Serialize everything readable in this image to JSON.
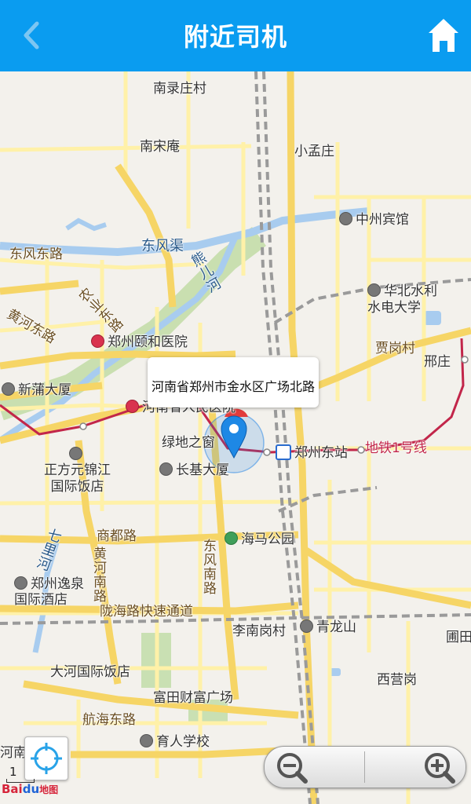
{
  "header": {
    "title": "附近司机",
    "back_icon": "chevron-left-icon",
    "home_icon": "home-icon",
    "background": "#0a9cf0"
  },
  "map": {
    "location_popup": "河南省郑州市金水区广场北路",
    "labels": {
      "nanluzhuangcun": "南录庄村",
      "nansongan": "南宋庵",
      "xiaomengzhuang": "小孟庄",
      "zhongzhou_hotel": "中州宾馆",
      "dongfengqu": "东风渠",
      "dongfeng_east_rd": "东风东路",
      "longhai_canal": "熊儿河",
      "nongye_east_rd": "农业东路",
      "huabei_univ": "华北水利\n水电大学",
      "huanghe_east_rd": "黄河东路",
      "yihe_hospital": "郑州颐和医院",
      "jiagangcun": "贾岗村",
      "xingzhuang": "邢庄",
      "xinpu_building": "新蒲大厦",
      "henan_hospital": "河南省人民医院",
      "greenland_window": "绿地之窗",
      "zhengzhou_east_station": "郑州东站",
      "metro_line1": "地铁1号线",
      "zhengfang_hotel": "正方元锦江\n国际饭店",
      "changji_building": "长基大厦",
      "qili_river": "七里河",
      "shangdu_rd": "商都路",
      "huanghe_south_rd": "黄河南路",
      "dongfeng_south_rd": "东风南路",
      "haima_park": "海马公园",
      "yiquan_hotel": "郑州逸泉\n国际酒店",
      "longhai_expressway": "陇海路快速通道",
      "linanganggcun": "李南岗村",
      "qinglongshan": "青龙山",
      "putian": "圃田",
      "xiyinggang": "西营岗",
      "dahe_hotel": "大河国际饭店",
      "futian_plaza": "富田财富广场",
      "hanghai_east_rd": "航海东路",
      "yuren_school": "育人学校",
      "henan_edge": "河南"
    }
  },
  "controls": {
    "locate_icon": "crosshair-icon",
    "zoom_out_icon": "zoom-out-icon",
    "zoom_in_icon": "zoom-in-icon",
    "scale": "1",
    "logo_bai": "Bai",
    "logo_du": "du",
    "logo_map": "地图"
  },
  "colors": {
    "major_road": "#f6d566",
    "road": "#fff3b0",
    "metro": "#c2264a",
    "water": "#a8ccef",
    "rail": "#9a9a9a"
  }
}
